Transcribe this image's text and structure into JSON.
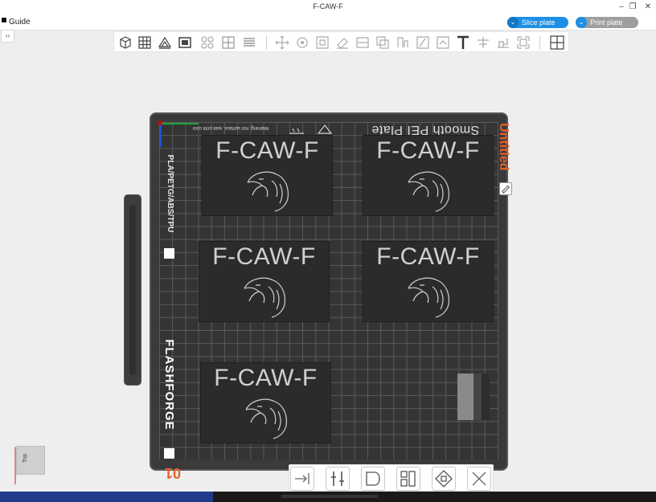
{
  "window": {
    "title": "F-CAW-F",
    "controls": [
      "minimize-icon",
      "restore-icon",
      "close-icon"
    ]
  },
  "menubar": {
    "guide_label": "Guide",
    "slice_label": "Slice plate",
    "print_label": "Print plate"
  },
  "toolbar": {
    "icons": [
      "add-cube-icon",
      "grid-icon",
      "orient-icon",
      "plate-icon",
      "arrange-icon",
      "split-icon",
      "layers-icon",
      "move-icon",
      "rotate-icon",
      "scale-icon",
      "lay-on-face-icon",
      "cut-icon",
      "boolean-icon",
      "support-paint-icon",
      "seam-paint-icon",
      "color-paint-icon",
      "text-icon",
      "measure-icon",
      "assembly-icon",
      "split-parts-icon",
      "variable-layer-icon"
    ]
  },
  "plate": {
    "warning": "Warning: hot surface, wait until cool",
    "plate_type": "Smooth PEI Plate",
    "name": "Untitled",
    "material": "PLA/PETG/ABS/TPU",
    "brand": "FLASHFORGE",
    "number": "01"
  },
  "parts": [
    {
      "label": "F-CAW-F"
    },
    {
      "label": "F-CAW-F"
    },
    {
      "label": "F-CAW-F"
    },
    {
      "label": "F-CAW-F"
    },
    {
      "label": "F-CAW-F"
    }
  ],
  "bottom_toolbar": {
    "icons": [
      "export-icon",
      "settings-icon",
      "arrange-plate-icon",
      "orient-plate-icon",
      "lock-plate-icon",
      "delete-plate-icon"
    ]
  },
  "orientation": {
    "view_label": "Top"
  },
  "colors": {
    "accent": "#1d8fe6",
    "plate_label": "#e8612c",
    "plate": "#3a3a3a"
  }
}
